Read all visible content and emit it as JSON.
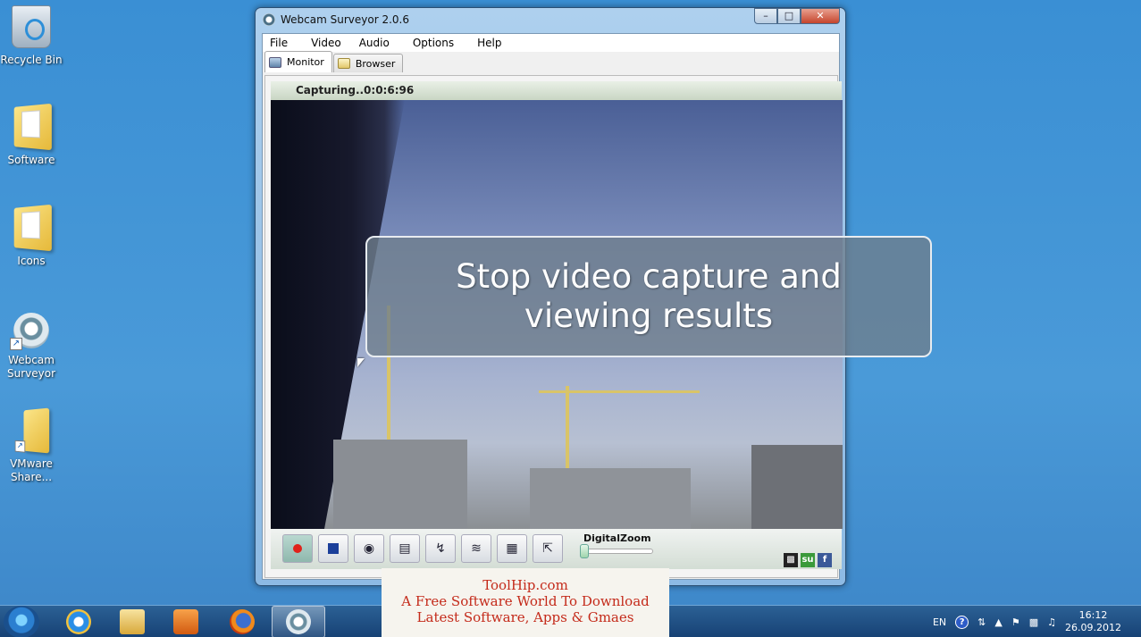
{
  "desktop": {
    "icons": [
      {
        "label": "Recycle Bin",
        "icon": "recycle-bin-icon"
      },
      {
        "label": "Software",
        "icon": "folder-icon"
      },
      {
        "label": "Icons",
        "icon": "folder-icon"
      },
      {
        "label": "Webcam Surveyor",
        "icon": "webcam-icon"
      },
      {
        "label": "VMware Share...",
        "icon": "folder-icon"
      }
    ]
  },
  "window": {
    "title": "Webcam Surveyor 2.0.6",
    "menu": [
      "File",
      "Video",
      "Audio",
      "Options",
      "Help"
    ],
    "tabs": [
      {
        "label": "Monitor",
        "active": true
      },
      {
        "label": "Browser",
        "active": false
      }
    ],
    "status": "Capturing..0:0:6:96",
    "overlay_line1": "Stop video capture and",
    "overlay_line2": "viewing results",
    "zoom_label": "DigitalZoom",
    "zoom_level": 0,
    "control_icons": [
      "record-icon",
      "stop-icon",
      "snapshot-icon",
      "video-file-icon",
      "motion-detector-icon",
      "wireless-broadcast-icon",
      "screen-capture-icon",
      "fullscreen-icon"
    ]
  },
  "watermark": {
    "line1": "ToolHip.com",
    "line2": "A Free Software World To Download",
    "line3": "Latest Software, Apps & Gmaes"
  },
  "taskbar": {
    "language": "EN",
    "time": "16:12",
    "date": "26.09.2012"
  },
  "colors": {
    "desktop_bg": "#3a8fd4",
    "watermark_text": "#c42a1a",
    "record_red": "#e0221a"
  }
}
